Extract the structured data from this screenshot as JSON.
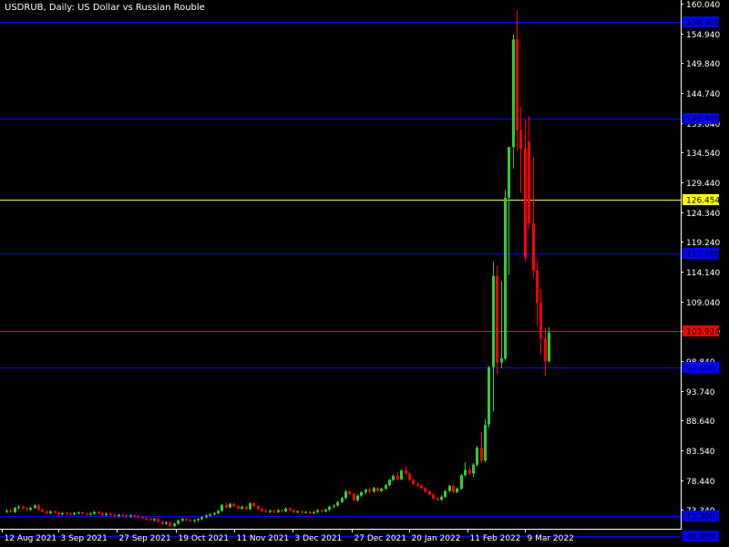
{
  "chart_data": {
    "type": "candlestick",
    "title": "USDRUB, Daily:  US Dollar vs Russian Rouble",
    "colors": {
      "background": "#000000",
      "foreground": "#ffffff",
      "bull": "#32cd32",
      "bear": "#ff0000",
      "level_blue": "#0000ff",
      "level_yellow": "#ffff00",
      "level_red": "#ff0000",
      "label_text": "#000000"
    },
    "ylim": [
      70.44,
      160.04
    ],
    "y_ticks": [
      160.04,
      154.94,
      149.84,
      144.74,
      139.64,
      134.54,
      129.44,
      124.34,
      119.24,
      114.14,
      109.04,
      103.94,
      98.84,
      93.74,
      88.64,
      83.54,
      78.44,
      73.34
    ],
    "y_tick_labels": [
      "160.040",
      "154.940",
      "149.840",
      "144.740",
      "139.640",
      "134.540",
      "129.440",
      "124.340",
      "119.240",
      "114.140",
      "109.040",
      "103.940",
      "98.840",
      "93.740",
      "88.640",
      "83.540",
      "78.440",
      "73.340"
    ],
    "x_labels": [
      "12 Aug 2021",
      "3 Sep 2021",
      "27 Sep 2021",
      "19 Oct 2021",
      "11 Nov 2021",
      "3 Dec 2021",
      "27 Dec 2021",
      "20 Jan 2022",
      "11 Feb 2022",
      "9 Mar 2022"
    ],
    "levels": [
      {
        "value": 126.454,
        "label": "126.454",
        "color": "yellow"
      },
      {
        "value": 103.924,
        "label": "103.924",
        "color": "red"
      },
      {
        "value": 156.9,
        "label": "156.900",
        "color": "blue"
      },
      {
        "value": 140.4,
        "label": "140.400",
        "color": "blue"
      },
      {
        "value": 117.2,
        "label": "117.200",
        "color": "blue"
      },
      {
        "value": 97.8,
        "label": "97.800",
        "color": "blue"
      },
      {
        "value": 72.3,
        "label": "72.300",
        "color": "blue"
      },
      {
        "value": 68.9,
        "label": "68.900",
        "color": "blue"
      }
    ],
    "candles": [
      {
        "o": 73.1,
        "h": 73.5,
        "l": 72.8,
        "c": 73.2
      },
      {
        "o": 73.2,
        "h": 73.6,
        "l": 72.9,
        "c": 73.0
      },
      {
        "o": 73.0,
        "h": 73.9,
        "l": 72.8,
        "c": 73.7
      },
      {
        "o": 73.7,
        "h": 74.2,
        "l": 73.4,
        "c": 73.9
      },
      {
        "o": 73.9,
        "h": 74.1,
        "l": 73.4,
        "c": 73.6
      },
      {
        "o": 73.6,
        "h": 73.9,
        "l": 73.2,
        "c": 73.4
      },
      {
        "o": 73.4,
        "h": 73.9,
        "l": 73.2,
        "c": 73.7
      },
      {
        "o": 73.7,
        "h": 74.3,
        "l": 73.5,
        "c": 74.1
      },
      {
        "o": 74.1,
        "h": 74.3,
        "l": 73.2,
        "c": 73.4
      },
      {
        "o": 73.4,
        "h": 73.6,
        "l": 72.9,
        "c": 73.1
      },
      {
        "o": 73.1,
        "h": 73.3,
        "l": 72.6,
        "c": 72.8
      },
      {
        "o": 72.8,
        "h": 73.3,
        "l": 72.6,
        "c": 73.1
      },
      {
        "o": 73.1,
        "h": 73.3,
        "l": 72.7,
        "c": 72.9
      },
      {
        "o": 72.9,
        "h": 73.1,
        "l": 72.4,
        "c": 72.6
      },
      {
        "o": 72.6,
        "h": 73.0,
        "l": 72.4,
        "c": 72.8
      },
      {
        "o": 72.8,
        "h": 73.0,
        "l": 72.5,
        "c": 72.7
      },
      {
        "o": 72.7,
        "h": 72.9,
        "l": 72.4,
        "c": 72.6
      },
      {
        "o": 72.6,
        "h": 73.0,
        "l": 72.4,
        "c": 72.8
      },
      {
        "o": 72.8,
        "h": 73.1,
        "l": 72.6,
        "c": 72.9
      },
      {
        "o": 72.9,
        "h": 73.1,
        "l": 72.5,
        "c": 72.7
      },
      {
        "o": 72.7,
        "h": 72.9,
        "l": 72.4,
        "c": 72.6
      },
      {
        "o": 72.6,
        "h": 72.9,
        "l": 72.4,
        "c": 72.7
      },
      {
        "o": 72.7,
        "h": 73.2,
        "l": 72.5,
        "c": 73.0
      },
      {
        "o": 73.0,
        "h": 73.2,
        "l": 72.6,
        "c": 72.8
      },
      {
        "o": 72.8,
        "h": 73.0,
        "l": 72.3,
        "c": 72.5
      },
      {
        "o": 72.5,
        "h": 72.9,
        "l": 72.3,
        "c": 72.7
      },
      {
        "o": 72.7,
        "h": 72.9,
        "l": 72.3,
        "c": 72.5
      },
      {
        "o": 72.5,
        "h": 72.7,
        "l": 72.1,
        "c": 72.3
      },
      {
        "o": 72.3,
        "h": 72.7,
        "l": 72.1,
        "c": 72.5
      },
      {
        "o": 72.5,
        "h": 72.8,
        "l": 72.2,
        "c": 72.4
      },
      {
        "o": 72.4,
        "h": 72.6,
        "l": 72.0,
        "c": 72.2
      },
      {
        "o": 72.2,
        "h": 72.6,
        "l": 72.0,
        "c": 72.4
      },
      {
        "o": 72.4,
        "h": 72.6,
        "l": 72.0,
        "c": 72.2
      },
      {
        "o": 72.2,
        "h": 72.5,
        "l": 71.9,
        "c": 72.1
      },
      {
        "o": 72.1,
        "h": 72.4,
        "l": 71.8,
        "c": 72.0
      },
      {
        "o": 72.0,
        "h": 72.2,
        "l": 71.6,
        "c": 71.8
      },
      {
        "o": 71.8,
        "h": 72.1,
        "l": 71.5,
        "c": 71.6
      },
      {
        "o": 71.6,
        "h": 72.0,
        "l": 71.4,
        "c": 71.8
      },
      {
        "o": 71.8,
        "h": 72.0,
        "l": 71.2,
        "c": 71.3
      },
      {
        "o": 71.3,
        "h": 71.5,
        "l": 70.8,
        "c": 71.0
      },
      {
        "o": 71.0,
        "h": 71.4,
        "l": 70.8,
        "c": 71.2
      },
      {
        "o": 71.2,
        "h": 71.4,
        "l": 70.4,
        "c": 70.6
      },
      {
        "o": 70.6,
        "h": 71.2,
        "l": 70.4,
        "c": 71.0
      },
      {
        "o": 71.0,
        "h": 71.7,
        "l": 70.8,
        "c": 71.5
      },
      {
        "o": 71.5,
        "h": 72.0,
        "l": 71.3,
        "c": 71.8
      },
      {
        "o": 71.8,
        "h": 72.0,
        "l": 71.4,
        "c": 71.6
      },
      {
        "o": 71.6,
        "h": 71.9,
        "l": 71.3,
        "c": 71.5
      },
      {
        "o": 71.5,
        "h": 71.8,
        "l": 71.2,
        "c": 71.6
      },
      {
        "o": 71.6,
        "h": 72.0,
        "l": 71.4,
        "c": 71.8
      },
      {
        "o": 71.8,
        "h": 72.3,
        "l": 71.6,
        "c": 72.1
      },
      {
        "o": 72.1,
        "h": 72.6,
        "l": 71.9,
        "c": 72.4
      },
      {
        "o": 72.4,
        "h": 72.8,
        "l": 72.2,
        "c": 72.6
      },
      {
        "o": 72.6,
        "h": 73.0,
        "l": 72.4,
        "c": 72.8
      },
      {
        "o": 72.8,
        "h": 73.4,
        "l": 72.6,
        "c": 73.2
      },
      {
        "o": 73.2,
        "h": 74.4,
        "l": 73.0,
        "c": 74.2
      },
      {
        "o": 74.2,
        "h": 74.6,
        "l": 73.6,
        "c": 73.8
      },
      {
        "o": 73.8,
        "h": 74.6,
        "l": 73.6,
        "c": 74.4
      },
      {
        "o": 74.4,
        "h": 74.6,
        "l": 73.8,
        "c": 74.0
      },
      {
        "o": 74.0,
        "h": 74.2,
        "l": 73.4,
        "c": 73.6
      },
      {
        "o": 73.6,
        "h": 74.1,
        "l": 73.4,
        "c": 73.9
      },
      {
        "o": 73.9,
        "h": 74.1,
        "l": 73.3,
        "c": 73.5
      },
      {
        "o": 73.5,
        "h": 74.7,
        "l": 73.3,
        "c": 74.5
      },
      {
        "o": 74.5,
        "h": 74.7,
        "l": 73.8,
        "c": 74.0
      },
      {
        "o": 74.0,
        "h": 74.2,
        "l": 73.3,
        "c": 73.5
      },
      {
        "o": 73.5,
        "h": 73.7,
        "l": 73.0,
        "c": 73.2
      },
      {
        "o": 73.2,
        "h": 73.5,
        "l": 72.9,
        "c": 73.0
      },
      {
        "o": 73.0,
        "h": 73.4,
        "l": 72.8,
        "c": 73.2
      },
      {
        "o": 73.2,
        "h": 73.4,
        "l": 72.8,
        "c": 73.0
      },
      {
        "o": 73.0,
        "h": 73.5,
        "l": 72.8,
        "c": 73.3
      },
      {
        "o": 73.3,
        "h": 73.5,
        "l": 72.9,
        "c": 73.1
      },
      {
        "o": 73.1,
        "h": 73.8,
        "l": 72.9,
        "c": 73.6
      },
      {
        "o": 73.6,
        "h": 73.8,
        "l": 73.1,
        "c": 73.3
      },
      {
        "o": 73.3,
        "h": 73.5,
        "l": 72.8,
        "c": 73.0
      },
      {
        "o": 73.0,
        "h": 73.3,
        "l": 72.8,
        "c": 73.1
      },
      {
        "o": 73.1,
        "h": 73.3,
        "l": 72.7,
        "c": 72.9
      },
      {
        "o": 72.9,
        "h": 73.2,
        "l": 72.7,
        "c": 73.0
      },
      {
        "o": 73.0,
        "h": 73.2,
        "l": 72.6,
        "c": 72.8
      },
      {
        "o": 72.8,
        "h": 73.2,
        "l": 72.6,
        "c": 73.0
      },
      {
        "o": 73.0,
        "h": 73.5,
        "l": 72.8,
        "c": 73.3
      },
      {
        "o": 73.3,
        "h": 73.5,
        "l": 72.9,
        "c": 73.1
      },
      {
        "o": 73.1,
        "h": 73.6,
        "l": 72.9,
        "c": 73.4
      },
      {
        "o": 73.4,
        "h": 74.1,
        "l": 73.2,
        "c": 73.9
      },
      {
        "o": 73.9,
        "h": 74.3,
        "l": 73.6,
        "c": 74.1
      },
      {
        "o": 74.1,
        "h": 74.9,
        "l": 73.9,
        "c": 74.7
      },
      {
        "o": 74.7,
        "h": 75.6,
        "l": 74.5,
        "c": 75.4
      },
      {
        "o": 75.4,
        "h": 76.8,
        "l": 75.2,
        "c": 76.5
      },
      {
        "o": 76.5,
        "h": 76.7,
        "l": 75.9,
        "c": 76.1
      },
      {
        "o": 76.1,
        "h": 76.3,
        "l": 74.8,
        "c": 75.0
      },
      {
        "o": 75.0,
        "h": 76.0,
        "l": 74.8,
        "c": 75.8
      },
      {
        "o": 75.8,
        "h": 76.6,
        "l": 75.6,
        "c": 76.4
      },
      {
        "o": 76.4,
        "h": 77.0,
        "l": 76.0,
        "c": 76.8
      },
      {
        "o": 76.8,
        "h": 77.2,
        "l": 76.2,
        "c": 76.5
      },
      {
        "o": 76.5,
        "h": 77.3,
        "l": 76.3,
        "c": 77.1
      },
      {
        "o": 77.1,
        "h": 77.3,
        "l": 76.4,
        "c": 76.6
      },
      {
        "o": 76.6,
        "h": 77.2,
        "l": 76.4,
        "c": 77.0
      },
      {
        "o": 77.0,
        "h": 77.8,
        "l": 76.8,
        "c": 77.6
      },
      {
        "o": 77.6,
        "h": 78.7,
        "l": 77.4,
        "c": 78.5
      },
      {
        "o": 78.5,
        "h": 79.4,
        "l": 78.3,
        "c": 79.2
      },
      {
        "o": 79.2,
        "h": 79.9,
        "l": 78.4,
        "c": 78.6
      },
      {
        "o": 78.6,
        "h": 80.3,
        "l": 78.4,
        "c": 80.1
      },
      {
        "o": 80.1,
        "h": 81.0,
        "l": 79.4,
        "c": 79.6
      },
      {
        "o": 79.6,
        "h": 79.8,
        "l": 78.3,
        "c": 78.5
      },
      {
        "o": 78.5,
        "h": 78.7,
        "l": 77.6,
        "c": 77.8
      },
      {
        "o": 77.8,
        "h": 78.0,
        "l": 77.3,
        "c": 77.5
      },
      {
        "o": 77.5,
        "h": 77.7,
        "l": 76.9,
        "c": 77.1
      },
      {
        "o": 77.1,
        "h": 77.3,
        "l": 76.3,
        "c": 76.5
      },
      {
        "o": 76.5,
        "h": 76.7,
        "l": 75.8,
        "c": 76.0
      },
      {
        "o": 76.0,
        "h": 76.2,
        "l": 75.1,
        "c": 75.3
      },
      {
        "o": 75.3,
        "h": 75.6,
        "l": 74.9,
        "c": 75.1
      },
      {
        "o": 75.1,
        "h": 75.9,
        "l": 74.9,
        "c": 75.6
      },
      {
        "o": 75.6,
        "h": 76.8,
        "l": 75.4,
        "c": 76.6
      },
      {
        "o": 76.6,
        "h": 77.7,
        "l": 76.4,
        "c": 77.5
      },
      {
        "o": 77.5,
        "h": 77.7,
        "l": 76.2,
        "c": 76.4
      },
      {
        "o": 76.4,
        "h": 77.2,
        "l": 76.2,
        "c": 77.0
      },
      {
        "o": 77.0,
        "h": 79.5,
        "l": 76.8,
        "c": 79.3
      },
      {
        "o": 79.3,
        "h": 81.5,
        "l": 79.1,
        "c": 80.2
      },
      {
        "o": 80.2,
        "h": 80.6,
        "l": 79.4,
        "c": 79.6
      },
      {
        "o": 79.6,
        "h": 81.4,
        "l": 79.0,
        "c": 81.1
      },
      {
        "o": 81.1,
        "h": 84.3,
        "l": 80.8,
        "c": 84.0
      },
      {
        "o": 84.0,
        "h": 86.7,
        "l": 81.3,
        "c": 81.8
      },
      {
        "o": 81.8,
        "h": 88.9,
        "l": 81.5,
        "c": 87.9
      },
      {
        "o": 88.0,
        "h": 98.0,
        "l": 87.4,
        "c": 97.8
      },
      {
        "o": 97.8,
        "h": 115.8,
        "l": 90.2,
        "c": 113.4
      },
      {
        "o": 113.4,
        "h": 115.2,
        "l": 96.6,
        "c": 98.6
      },
      {
        "o": 98.6,
        "h": 112.5,
        "l": 97.6,
        "c": 99.3
      },
      {
        "o": 99.3,
        "h": 128.1,
        "l": 98.9,
        "c": 126.8
      },
      {
        "o": 126.8,
        "h": 131.2,
        "l": 113.6,
        "c": 135.5
      },
      {
        "o": 135.5,
        "h": 154.8,
        "l": 131.8,
        "c": 153.9
      },
      {
        "o": 153.9,
        "h": 158.8,
        "l": 134.8,
        "c": 138.4
      },
      {
        "o": 138.4,
        "h": 142.4,
        "l": 127.6,
        "c": 135.2
      },
      {
        "o": 135.2,
        "h": 140.3,
        "l": 115.9,
        "c": 116.5
      },
      {
        "o": 136.4,
        "h": 140.8,
        "l": 121.4,
        "c": 122.4
      },
      {
        "o": 122.4,
        "h": 133.8,
        "l": 113.1,
        "c": 114.3
      },
      {
        "o": 114.3,
        "h": 116.1,
        "l": 104.9,
        "c": 108.8
      },
      {
        "o": 108.8,
        "h": 111.2,
        "l": 99.9,
        "c": 102.7
      },
      {
        "o": 102.7,
        "h": 104.6,
        "l": 96.2,
        "c": 98.8
      },
      {
        "o": 98.8,
        "h": 104.6,
        "l": 98.6,
        "c": 103.7
      }
    ]
  }
}
